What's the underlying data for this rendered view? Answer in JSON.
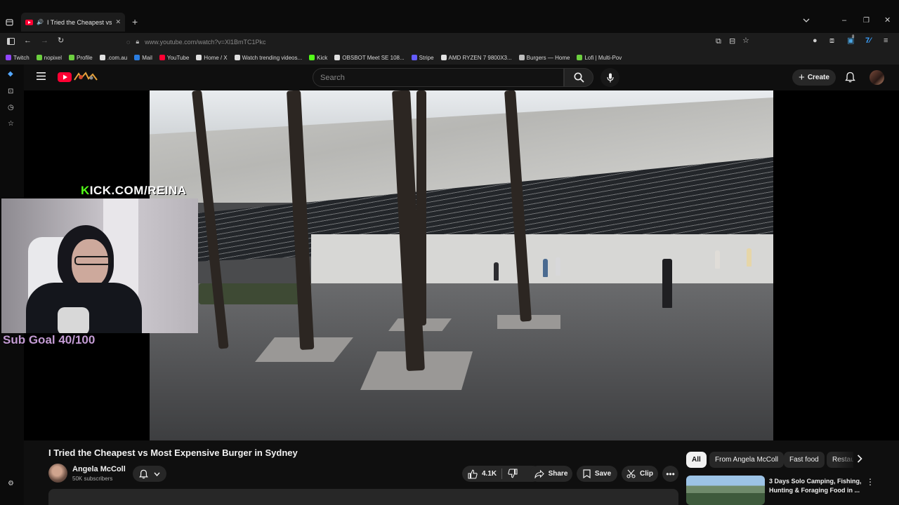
{
  "browser": {
    "tab_title": "I Tried the Cheapest vs Most Expensive Burger in Sydney",
    "url": "www.youtube.com/watch?v=Xl1BmTC1Pkc",
    "extension_badge": "8",
    "bookmarks": [
      {
        "label": "Twitch",
        "icon": "twitch-icon",
        "color": "#9146ff"
      },
      {
        "label": "nopixel",
        "icon": "nopixel-icon",
        "color": "#6ccf3f"
      },
      {
        "label": "Profile",
        "icon": "profile-icon",
        "color": "#6ccf3f"
      },
      {
        "label": ".com.au",
        "icon": "site-icon",
        "color": "#e0e0e0"
      },
      {
        "label": "Mail",
        "icon": "mail-icon",
        "color": "#2a7de1"
      },
      {
        "label": "YouTube",
        "icon": "youtube-icon",
        "color": "#ff0033"
      },
      {
        "label": "Home / X",
        "icon": "x-icon",
        "color": "#e0e0e0"
      },
      {
        "label": "Watch trending videos...",
        "icon": "tiktok-icon",
        "color": "#e0e0e0"
      },
      {
        "label": "Kick",
        "icon": "kick-icon",
        "color": "#53fc18"
      },
      {
        "label": "OBSBOT Meet SE 108...",
        "icon": "amazon-icon",
        "color": "#e0e0e0"
      },
      {
        "label": "Stripe",
        "icon": "stripe-icon",
        "color": "#635bff"
      },
      {
        "label": "AMD RYZEN 7 9800X3...",
        "icon": "amazon-icon",
        "color": "#e0e0e0"
      },
      {
        "label": "Burgers — Home",
        "icon": "globe-icon",
        "color": "#bdbdbd"
      },
      {
        "label": "Lofi | Multi-Pov",
        "icon": "lofi-icon",
        "color": "#6ccf3f"
      }
    ]
  },
  "masthead": {
    "search_placeholder": "Search",
    "create_label": "Create"
  },
  "overlay": {
    "kick_prefix": "K",
    "kick_rest": "ICK.COM/REINA",
    "sub_goal": "Sub Goal 40/100"
  },
  "video": {
    "title": "I Tried the Cheapest vs Most Expensive Burger in Sydney",
    "channel_name": "Angela McColl",
    "subscribers": "50K subscribers",
    "likes": "4.1K",
    "share_label": "Share",
    "save_label": "Save",
    "clip_label": "Clip"
  },
  "chips": [
    "All",
    "From Angela McColl",
    "Fast food",
    "Restaurants"
  ],
  "recommendation": {
    "title": "3 Days Solo Camping, Fishing, Hunting & Foraging Food in ..."
  },
  "colors": {
    "youtube_red": "#ff0033",
    "kick_green": "#53fc18",
    "sub_goal_purple": "#c39bd3"
  }
}
